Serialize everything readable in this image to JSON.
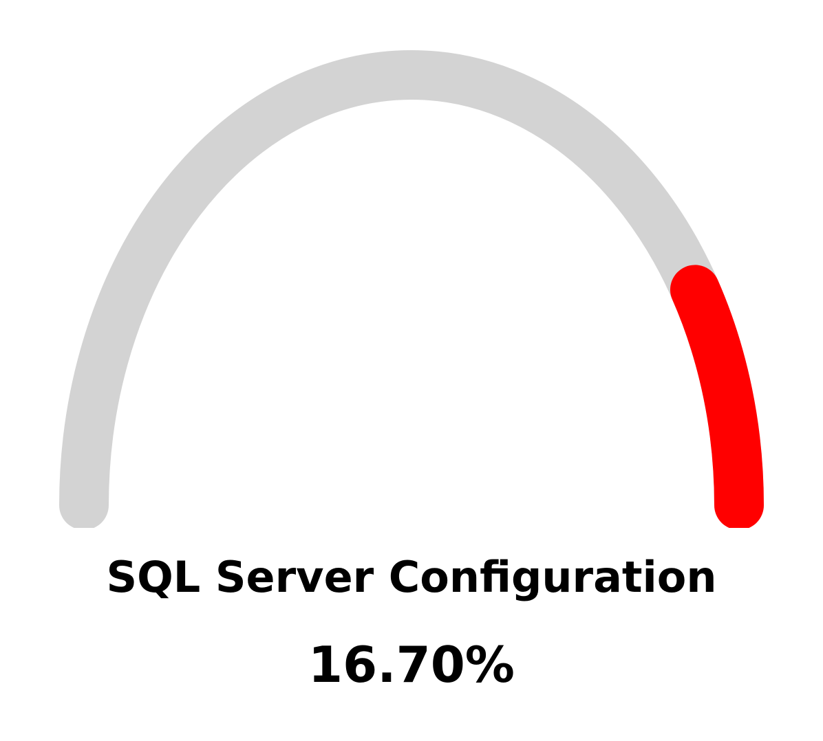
{
  "chart_data": {
    "type": "gauge",
    "title": "SQL Server Configuration",
    "value_label": "16.70%",
    "value": 16.7,
    "min": 0,
    "max": 100,
    "direction": "fills from right end toward left",
    "colors": {
      "track": "#d3d3d3",
      "fill": "#ff0000",
      "text": "#000000",
      "background": "#ffffff"
    }
  }
}
